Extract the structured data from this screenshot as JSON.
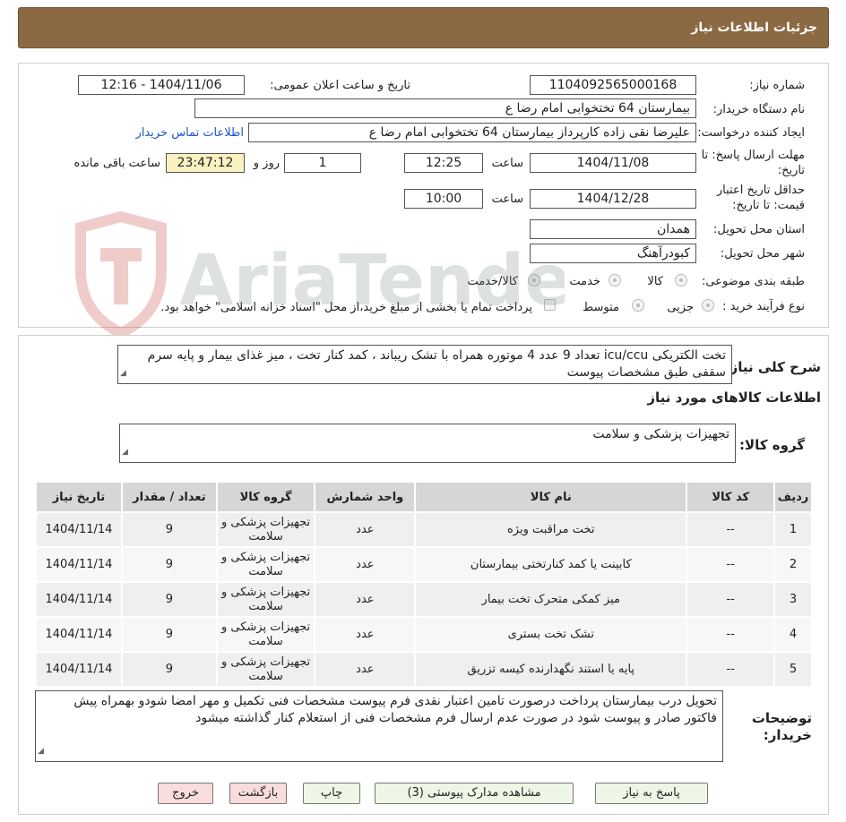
{
  "header": {
    "title": "جزئیات اطلاعات نیاز"
  },
  "info": {
    "need_number_label": "شماره نیاز:",
    "need_number": "1104092565000168",
    "announce_label": "تاریخ و ساعت اعلان عمومی:",
    "announce_value": "1404/11/06 - 12:16",
    "buyer_org_label": "نام دستگاه خریدار:",
    "buyer_org": "بیمارستان  64 تختخوابی امام رضا   ع",
    "creator_label": "ایجاد کننده درخواست:",
    "creator": "علیرضا نقی زاده کارپرداز بیمارستان  64 تختخوابی امام رضا   ع",
    "contact_link": "اطلاعات تماس خریدار",
    "deadline_label_1": "مهلت ارسال پاسخ: تا",
    "deadline_label_2": "تاریخ:",
    "deadline_date": "1404/11/08",
    "time_word": "ساعت",
    "deadline_time": "12:25",
    "days_value": "1",
    "days_word": "روز و",
    "remaining_time": "23:47:12",
    "remaining_word": "ساعت باقی مانده",
    "validity_label_1": "حداقل تاریخ اعتبار",
    "validity_label_2": "قیمت: تا تاریخ:",
    "validity_date": "1404/12/28",
    "validity_time": "10:00",
    "province_label": "استان محل تحویل:",
    "province": "همدان",
    "city_label": "شهر محل تحویل:",
    "city": "کبودرآهنگ",
    "category_label": "طبقه بندی موضوعی:",
    "category_options": [
      "کالا",
      "خدمت",
      "کالا/خدمت"
    ],
    "process_label": "نوع فرآیند خرید :",
    "process_options": [
      "جزیی",
      "متوسط"
    ],
    "payment_note": "پرداخت تمام یا بخشی از مبلغ خرید،از محل \"اسناد خزانه اسلامی\" خواهد بود."
  },
  "summary": {
    "label": "شرح کلی نیاز:",
    "text": "تخت الکتریکی icu/ccu  تعداد 9 عدد 4 موتوره همراه با تشک ریباند ، کمد کنار تخت ، میز غذای بیمار و پایه سرم سقفی طبق مشخصات پیوست"
  },
  "goods": {
    "section_title": "اطلاعات کالاهای مورد نیاز",
    "group_label": "گروه کالا:",
    "group_value": "تجهیزات پزشکی و سلامت",
    "columns": [
      "ردیف",
      "کد کالا",
      "نام کالا",
      "واحد شمارش",
      "گروه کالا",
      "تعداد / مقدار",
      "تاریخ نیاز"
    ],
    "rows": [
      [
        "1",
        "--",
        "تخت مراقبت ویژه",
        "عدد",
        "تجهیزات پزشکی و سلامت",
        "9",
        "1404/11/14"
      ],
      [
        "2",
        "--",
        "کابینت یا کمد کنارتختی بیمارستان",
        "عدد",
        "تجهیزات پزشکی و سلامت",
        "9",
        "1404/11/14"
      ],
      [
        "3",
        "--",
        "میز کمکی متحرک تخت بیمار",
        "عدد",
        "تجهیزات پزشکی و سلامت",
        "9",
        "1404/11/14"
      ],
      [
        "4",
        "--",
        "تشک تخت بستری",
        "عدد",
        "تجهیزات پزشکی و سلامت",
        "9",
        "1404/11/14"
      ],
      [
        "5",
        "--",
        "پایه یا استند نگهدارنده کیسه تزریق",
        "عدد",
        "تجهیزات پزشکی و سلامت",
        "9",
        "1404/11/14"
      ]
    ]
  },
  "notes": {
    "label_1": "توضیحات",
    "label_2": "خریدار:",
    "text": "تحویل درب بیمارستان پرداخت درصورت تامین اعتبار نقدی فرم پیوست مشخصات فنی تکمیل و مهر امضا شودو بهمراه پیش فاکتور صادر و پیوست شود در صورت عدم ارسال فرم مشخصات فنی از استعلام کنار گذاشته میشود"
  },
  "buttons": {
    "reply": "پاسخ به نیاز",
    "attachments": "مشاهده مدارک پیوستی (3)",
    "print": "چاپ",
    "back": "بازگشت",
    "exit": "خروج"
  },
  "watermark": {
    "brand": "AriaTender.neT"
  },
  "colors": {
    "header_bg": "#8b6a43",
    "link": "#1a55c9",
    "highlight": "#fbf2c2"
  }
}
